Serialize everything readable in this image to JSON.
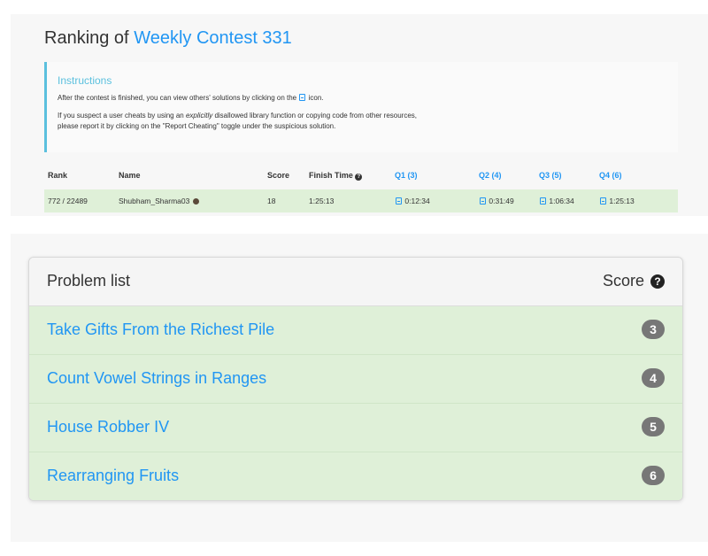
{
  "ranking": {
    "title_prefix": "Ranking of",
    "contest_name": "Weekly Contest 331",
    "instructions": {
      "title": "Instructions",
      "line1_before": "After the contest is finished, you can view others' solutions by clicking on the",
      "line1_after": "icon.",
      "line2_before": "If you suspect a user cheats by using an",
      "line2_em": "explicitly",
      "line2_after": "disallowed library function or copying code from other resources,",
      "line3": "please report it by clicking on the \"Report Cheating\" toggle under the suspicious solution."
    },
    "columns": {
      "rank": "Rank",
      "name": "Name",
      "score": "Score",
      "finish_time": "Finish Time",
      "q1": "Q1 (3)",
      "q2": "Q2 (4)",
      "q3": "Q3 (5)",
      "q4": "Q4 (6)"
    },
    "row": {
      "rank": "772 / 22489",
      "name": "Shubham_Sharma03",
      "score": "18",
      "finish_time": "1:25:13",
      "q1": "0:12:34",
      "q2": "0:31:49",
      "q3": "1:06:34",
      "q4": "1:25:13"
    }
  },
  "problem_list": {
    "title": "Problem list",
    "score_label": "Score",
    "help_glyph": "?",
    "problems": [
      {
        "name": "Take Gifts From the Richest Pile",
        "score": "3"
      },
      {
        "name": "Count Vowel Strings in Ranges",
        "score": "4"
      },
      {
        "name": "House Robber IV",
        "score": "5"
      },
      {
        "name": "Rearranging Fruits",
        "score": "6"
      }
    ]
  },
  "colors": {
    "accent": "#2196f3",
    "info": "#5bc0de",
    "success_bg": "#dff0d8",
    "badge": "#777777"
  }
}
